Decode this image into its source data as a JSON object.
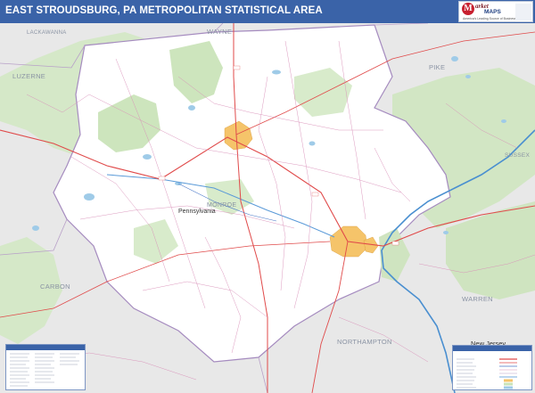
{
  "title": "EAST STROUDSBURG, PA METROPOLITAN STATISTICAL AREA",
  "logo": {
    "mark": "M",
    "line1": "arket",
    "line2": "MAPS",
    "tagline": "America's Leading Source of Business Maps"
  },
  "map_labels": {
    "wayne": "WAYNE",
    "luzerne": "LUZERNE",
    "lackawanna": "LACKAWANNA",
    "pike": "PIKE",
    "sussex": "SUSSEX",
    "monroe": "MONROE",
    "pennsylvania": "Pennsylvania",
    "carbon": "CARBON",
    "warren": "WARREN",
    "northampton": "NORTHAMPTON",
    "new_jersey": "New Jersey"
  },
  "colors": {
    "title_bar": "#3a63a8",
    "forest": "#c9e3b8",
    "urban": "#f5c46a",
    "water": "#9fcbe8",
    "outside": "#e8e8e8",
    "county_line": "#b8a0c8",
    "highway": "#e04a4a",
    "minor_road": "#d88fb8",
    "river": "#4a8fd0"
  }
}
